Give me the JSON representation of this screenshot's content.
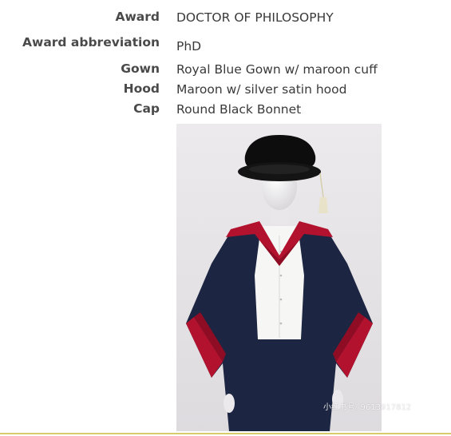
{
  "regalia": {
    "award": {
      "label": "Award",
      "value": "DOCTOR OF PHILOSOPHY"
    },
    "abbreviation": {
      "label": "Award abbreviation",
      "value": "PhD"
    },
    "gown": {
      "label": "Gown",
      "value": "Royal Blue Gown w/ maroon cuff"
    },
    "hood": {
      "label": "Hood",
      "value": "Maroon w/ silver satin hood"
    },
    "cap": {
      "label": "Cap",
      "value": "Round Black Bonnet"
    }
  },
  "watermark": {
    "badge": "小红书",
    "text": "小红书号: 9613917812"
  },
  "colors": {
    "gown": "#1c2541",
    "cuff": "#b3122e",
    "cap": "#0d0d0d",
    "rule": "#d9ca6a"
  }
}
